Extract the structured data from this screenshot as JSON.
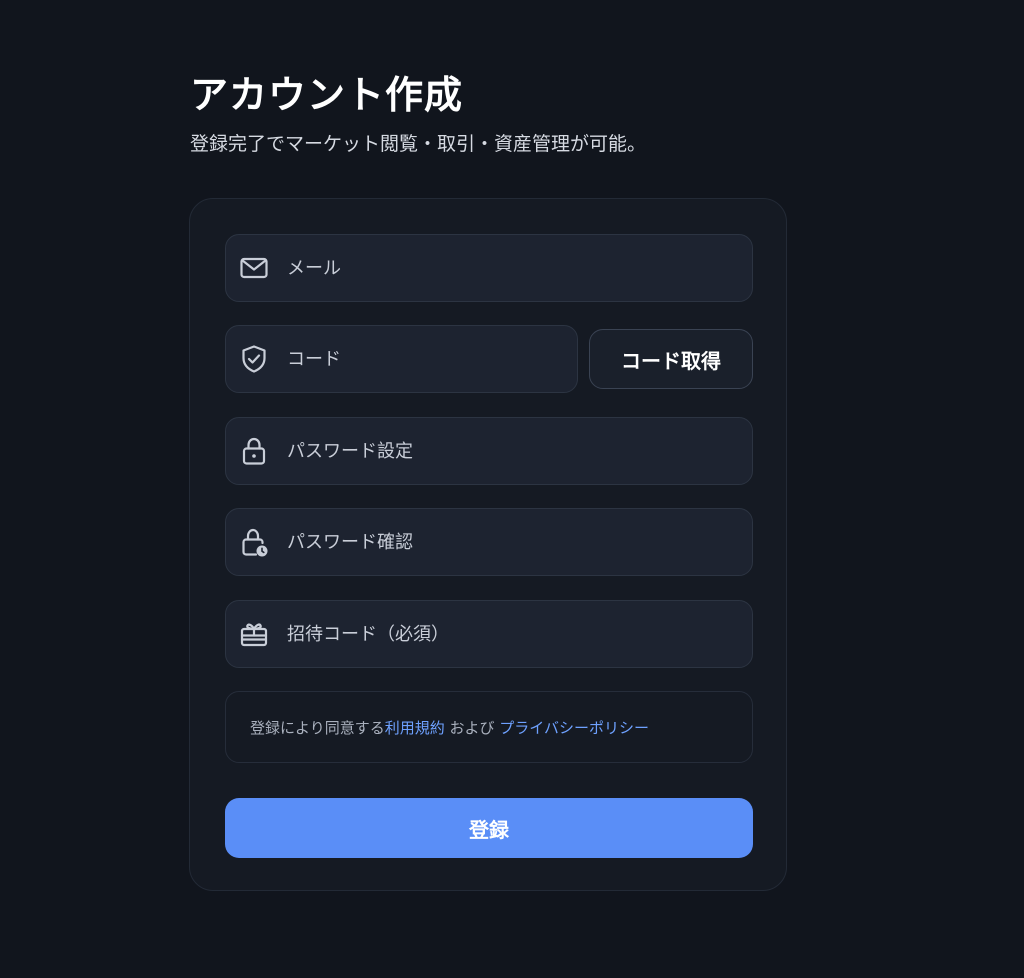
{
  "header": {
    "title": "アカウント作成",
    "subtitle": "登録完了でマーケット閲覧・取引・資産管理が可能。"
  },
  "form": {
    "email": {
      "placeholder": "メール",
      "icon": "mail-icon"
    },
    "code": {
      "placeholder": "コード",
      "icon": "shield-check-icon"
    },
    "get_code_label": "コード取得",
    "password": {
      "placeholder": "パスワード設定",
      "icon": "lock-icon"
    },
    "password_confirm": {
      "placeholder": "パスワード確認",
      "icon": "lock-clock-icon"
    },
    "invite": {
      "placeholder": "招待コード（必須）",
      "icon": "gift-icon"
    },
    "terms": {
      "prefix": "登録により同意する",
      "terms_link": "利用規約",
      "middle": " および ",
      "privacy_link": "プライバシーポリシー"
    },
    "submit_label": "登録"
  },
  "colors": {
    "background": "#11151d",
    "card": "#151a23",
    "field": "#1d2330",
    "accent": "#5a8ef7",
    "link": "#6ea1ff"
  }
}
